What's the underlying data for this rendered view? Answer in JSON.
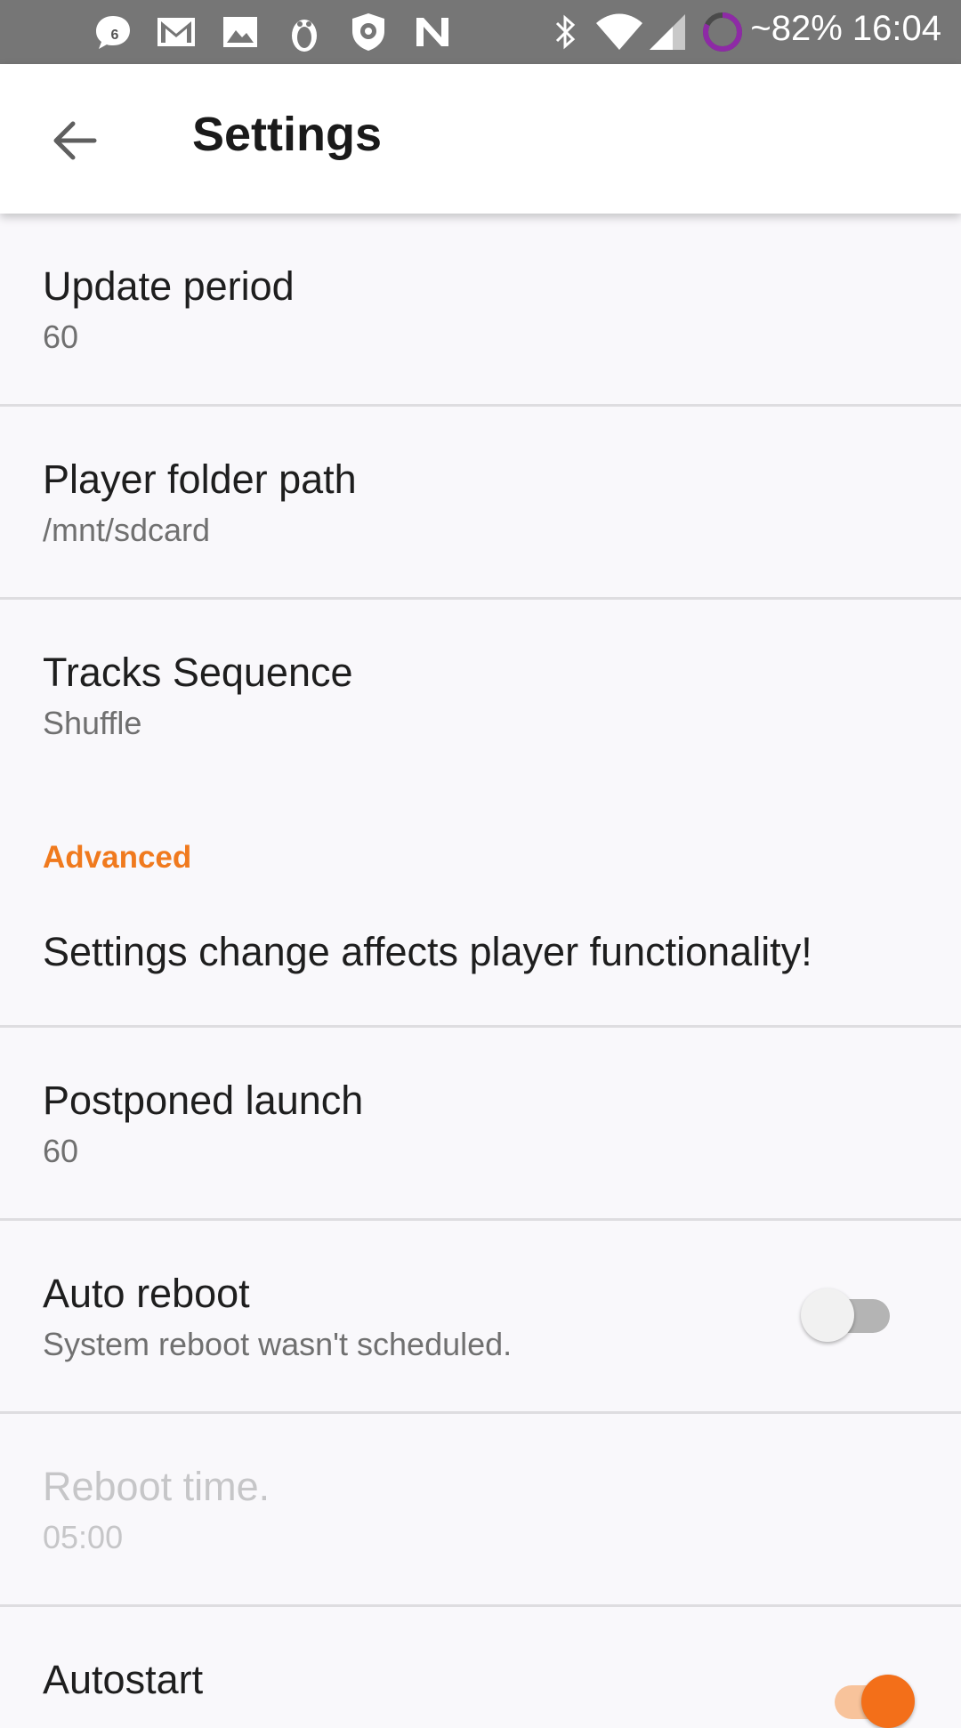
{
  "status_bar": {
    "notification_icons": [
      "notification-count-icon",
      "gmail-icon",
      "gallery-icon",
      "penguin-app-icon",
      "shield-app-icon",
      "n-app-icon"
    ],
    "notification_badge": "6",
    "system_icons": [
      "bluetooth-icon",
      "wifi-icon",
      "cell-signal-icon",
      "battery-ring-icon"
    ],
    "battery_text": "~82%",
    "time": "16:04"
  },
  "app_bar": {
    "title": "Settings",
    "back_icon": "arrow-back-icon"
  },
  "preferences": {
    "update_period": {
      "title": "Update period",
      "summary": "60"
    },
    "player_folder": {
      "title": "Player folder path",
      "summary": "/mnt/sdcard"
    },
    "tracks_sequence": {
      "title": "Tracks Sequence",
      "summary": "Shuffle"
    },
    "advanced_header": "Advanced",
    "warning": {
      "title": "Settings change affects player functionality!"
    },
    "postponed_launch": {
      "title": "Postponed launch",
      "summary": "60"
    },
    "auto_reboot": {
      "title": "Auto reboot",
      "summary": "System reboot wasn't scheduled.",
      "enabled": false
    },
    "reboot_time": {
      "title": "Reboot time.",
      "summary": "05:00",
      "disabled": true
    },
    "autostart": {
      "title": "Autostart",
      "enabled": true
    }
  },
  "colors": {
    "accent": "#f07a1e",
    "status_bar": "#767676",
    "background": "#f9f8fb"
  }
}
